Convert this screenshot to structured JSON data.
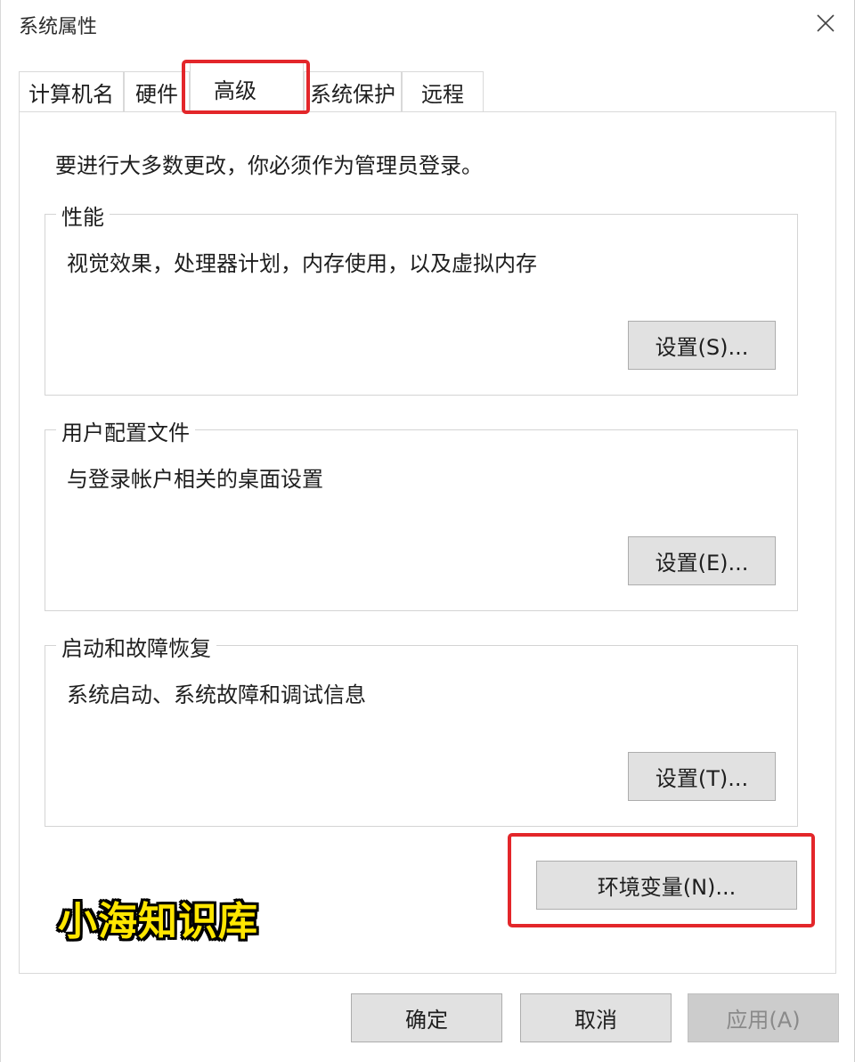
{
  "window": {
    "title": "系统属性"
  },
  "tabs": [
    {
      "label": "计算机名"
    },
    {
      "label": "硬件"
    },
    {
      "label": "高级"
    },
    {
      "label": "系统保护"
    },
    {
      "label": "远程"
    }
  ],
  "active_tab": "高级",
  "panel": {
    "admin_note": "要进行大多数更改，你必须作为管理员登录。",
    "groups": [
      {
        "title": "性能",
        "description": "视觉效果，处理器计划，内存使用，以及虚拟内存",
        "button": "设置(S)..."
      },
      {
        "title": "用户配置文件",
        "description": "与登录帐户相关的桌面设置",
        "button": "设置(E)..."
      },
      {
        "title": "启动和故障恢复",
        "description": "系统启动、系统故障和调试信息",
        "button": "设置(T)..."
      }
    ],
    "env_button": "环境变量(N)..."
  },
  "watermark": "小海知识库",
  "footer": {
    "ok": "确定",
    "cancel": "取消",
    "apply": "应用(A)"
  },
  "colors": {
    "highlight": "#e3262a",
    "watermark": "#ffe600"
  },
  "icons": {
    "close": "close-icon"
  }
}
